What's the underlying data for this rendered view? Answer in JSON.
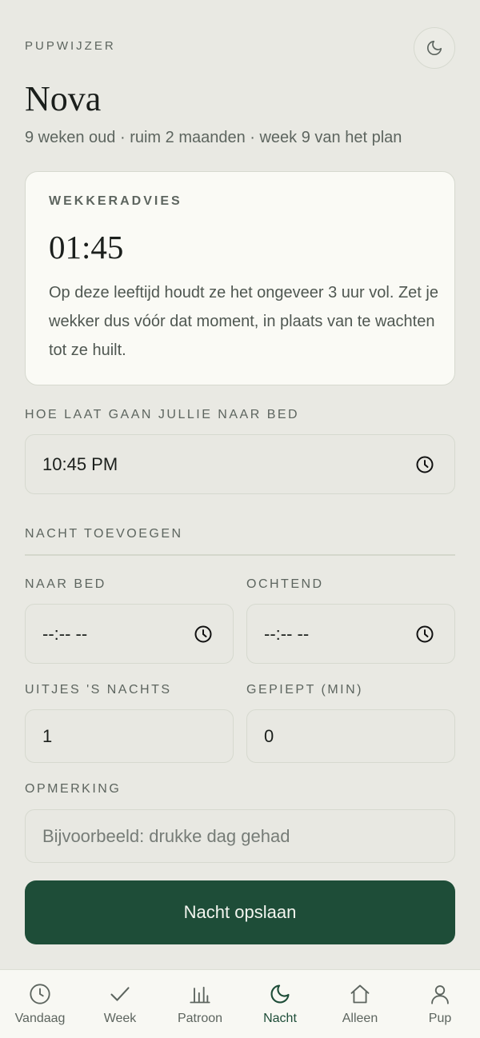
{
  "header": {
    "app_label": "PUPWIJZER",
    "pup_name": "Nova",
    "pup_meta": "9 weken oud · ruim 2 maanden · week 9 van het plan"
  },
  "advice": {
    "label": "WEKKERADVIES",
    "time": "01:45",
    "text": "Op deze leeftijd houdt ze het ongeveer 3 uur vol. Zet je wekker dus vóór dat moment, in plaats van te wachten tot ze huilt."
  },
  "bedtime": {
    "label": "HOE LAAT GAAN JULLIE NAAR BED",
    "value": "10:45 PM"
  },
  "add_night": {
    "label": "NACHT TOEVOEGEN",
    "to_bed_label": "NAAR BED",
    "to_bed_value": "--:-- --",
    "morning_label": "OCHTEND",
    "morning_value": "--:-- --",
    "outings_label": "UITJES 'S NACHTS",
    "outings_value": "1",
    "whined_label": "GEPIEPT (MIN)",
    "whined_value": "0",
    "note_label": "OPMERKING",
    "note_placeholder": "Bijvoorbeeld: drukke dag gehad",
    "save_label": "Nacht opslaan"
  },
  "nav": {
    "items": [
      {
        "label": "Vandaag",
        "icon": "clock-icon"
      },
      {
        "label": "Week",
        "icon": "check-icon"
      },
      {
        "label": "Patroon",
        "icon": "bar-chart-icon"
      },
      {
        "label": "Nacht",
        "icon": "moon-icon"
      },
      {
        "label": "Alleen",
        "icon": "home-icon"
      },
      {
        "label": "Pup",
        "icon": "user-icon"
      }
    ],
    "active": "Nacht"
  },
  "colors": {
    "background": "#e9e9e3",
    "accent": "#1e4d38",
    "card": "#fafaf5",
    "muted_text": "#5d655f"
  }
}
